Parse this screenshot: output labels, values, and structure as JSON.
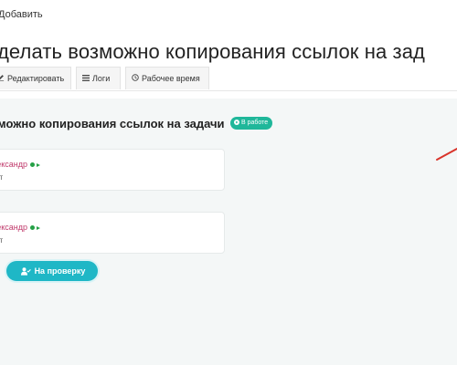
{
  "header": {
    "add_label": "Добавить",
    "page_title": "делать возможно копирования ссылок на зад"
  },
  "tabs": [
    {
      "label": "Редактировать",
      "icon": "edit-icon"
    },
    {
      "label": "Логи",
      "icon": "list-icon"
    },
    {
      "label": "Рабочее время",
      "icon": "clock-icon"
    }
  ],
  "task": {
    "title": "можно копирования ссылок на задачи",
    "status": "В работе",
    "status_color": "#1fb79a"
  },
  "assignees": [
    {
      "name": "лександр",
      "role": "ист",
      "name_color": "#c0396b",
      "status_color": "#25a046"
    },
    {
      "name": "лександр",
      "role": "ист",
      "name_color": "#c0396b",
      "status_color": "#25a046"
    }
  ],
  "actions": {
    "review_label": "На проверку",
    "button_color": "#1fb7c6"
  }
}
